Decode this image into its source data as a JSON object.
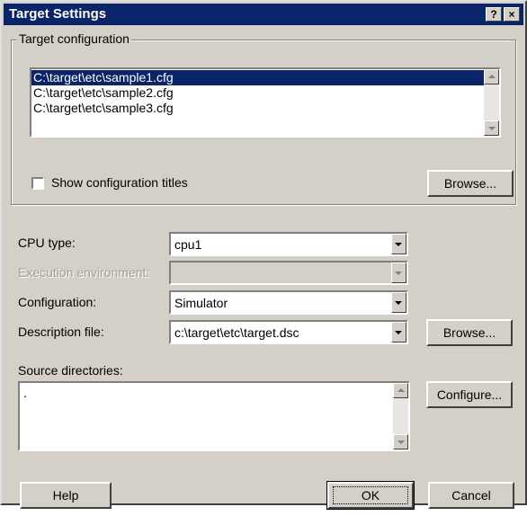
{
  "window": {
    "title": "Target Settings",
    "help_symbol": "?",
    "close_symbol": "×"
  },
  "target_config": {
    "legend": "Target configuration",
    "items": [
      {
        "label": "C:\\target\\etc\\sample1.cfg"
      },
      {
        "label": "C:\\target\\etc\\sample2.cfg"
      },
      {
        "label": "C:\\target\\etc\\sample3.cfg"
      }
    ],
    "selected_index": 0,
    "show_titles_label": "Show configuration titles",
    "show_titles_checked": false,
    "browse_label": "Browse..."
  },
  "cpu_type": {
    "label": "CPU type:",
    "value": "cpu1"
  },
  "execution_env": {
    "label": "Execution environment:",
    "value": "",
    "enabled": false
  },
  "configuration": {
    "label": "Configuration:",
    "value": "Simulator"
  },
  "description_file": {
    "label": "Description file:",
    "value": "c:\\target\\etc\\target.dsc",
    "browse_label": "Browse..."
  },
  "source_dirs": {
    "label": "Source directories:",
    "value": ".",
    "configure_label": "Configure..."
  },
  "footer": {
    "help_label": "Help",
    "ok_label": "OK",
    "cancel_label": "Cancel"
  },
  "colors": {
    "titlebar": "#0a246a",
    "face": "#d4d0c8",
    "selection": "#0a246a"
  }
}
